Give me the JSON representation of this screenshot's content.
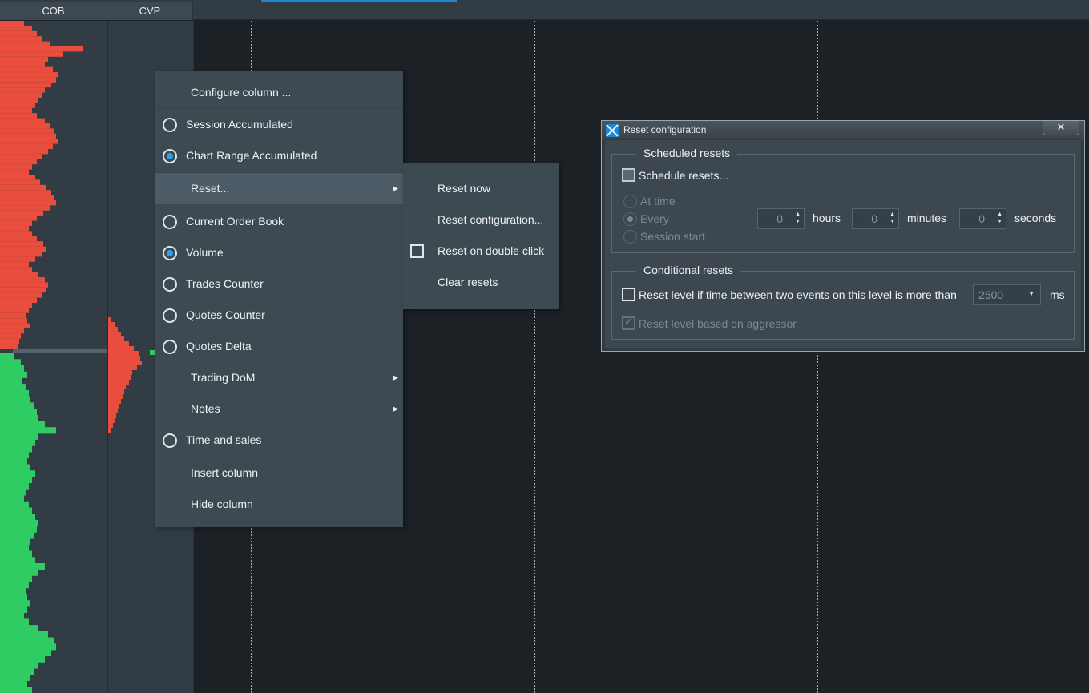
{
  "columns": {
    "cob_label": "COB",
    "cvp_label": "CVP"
  },
  "context_menu": {
    "configure": "Configure column ...",
    "items": [
      {
        "label": "Session Accumulated",
        "selected": false
      },
      {
        "label": "Chart Range Accumulated",
        "selected": true
      }
    ],
    "reset_label": "Reset...",
    "items2": [
      {
        "label": "Current Order Book",
        "selected": false
      },
      {
        "label": "Volume",
        "selected": true
      },
      {
        "label": "Trades Counter",
        "selected": false
      },
      {
        "label": "Quotes Counter",
        "selected": false
      },
      {
        "label": "Quotes Delta",
        "selected": false
      }
    ],
    "trading_dom": "Trading DoM",
    "notes": "Notes",
    "time_and_sales": "Time and sales",
    "insert_column": "Insert column",
    "hide_column": "Hide column"
  },
  "reset_submenu": {
    "reset_now": "Reset now",
    "reset_configuration": "Reset configuration...",
    "reset_on_double_click": "Reset on double click",
    "clear_resets": "Clear resets"
  },
  "dialog": {
    "title": "Reset configuration",
    "close": "✕",
    "scheduled": {
      "title": "Scheduled resets",
      "schedule_label": "Schedule resets...",
      "at_time": "At time",
      "every": "Every",
      "session_start": "Session start",
      "hours_value": "0",
      "hours_label": "hours",
      "minutes_value": "0",
      "minutes_label": "minutes",
      "seconds_value": "0",
      "seconds_label": "seconds"
    },
    "conditional": {
      "title": "Conditional resets",
      "reset_level_label": "Reset level if time between two events on this level is more than",
      "ms_value": "2500",
      "ms_label": "ms",
      "aggressor_label": "Reset level based on aggressor"
    }
  },
  "colors": {
    "ask": "#e84d3d",
    "bid": "#2ecc62",
    "accent": "#2aa3ea"
  }
}
